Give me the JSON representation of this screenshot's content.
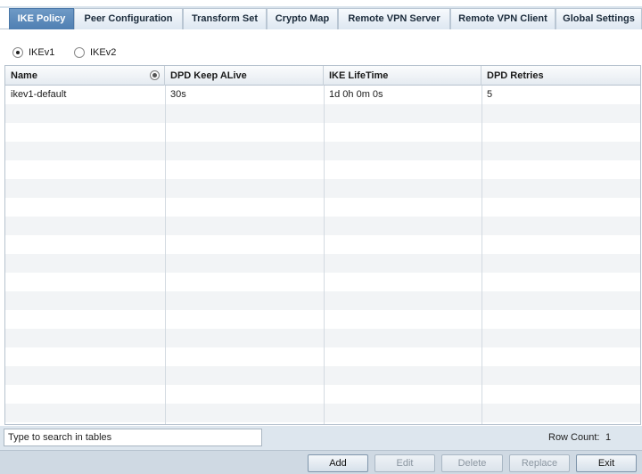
{
  "tabs": [
    {
      "label": "IKE Policy",
      "active": true
    },
    {
      "label": "Peer Configuration",
      "active": false
    },
    {
      "label": "Transform Set",
      "active": false
    },
    {
      "label": "Crypto Map",
      "active": false
    },
    {
      "label": "Remote VPN Server",
      "active": false
    },
    {
      "label": "Remote VPN Client",
      "active": false
    },
    {
      "label": "Global Settings",
      "active": false
    }
  ],
  "ike_version": {
    "options": [
      {
        "label": "IKEv1",
        "selected": true
      },
      {
        "label": "IKEv2",
        "selected": false
      }
    ]
  },
  "table": {
    "columns": [
      "Name",
      "DPD Keep ALive",
      "IKE LifeTime",
      "DPD Retries"
    ],
    "rows": [
      [
        "ikev1-default",
        "30s",
        "1d 0h 0m 0s",
        "5"
      ]
    ]
  },
  "search": {
    "placeholder": "Type to search in tables",
    "value": ""
  },
  "row_count": {
    "label": "Row  Count:",
    "value": "1"
  },
  "buttons": {
    "add": "Add",
    "edit": "Edit",
    "delete": "Delete",
    "replace": "Replace",
    "exit": "Exit"
  },
  "colors": {
    "active_tab": "#5a88b9",
    "accent_bar": "#dde6ee"
  }
}
